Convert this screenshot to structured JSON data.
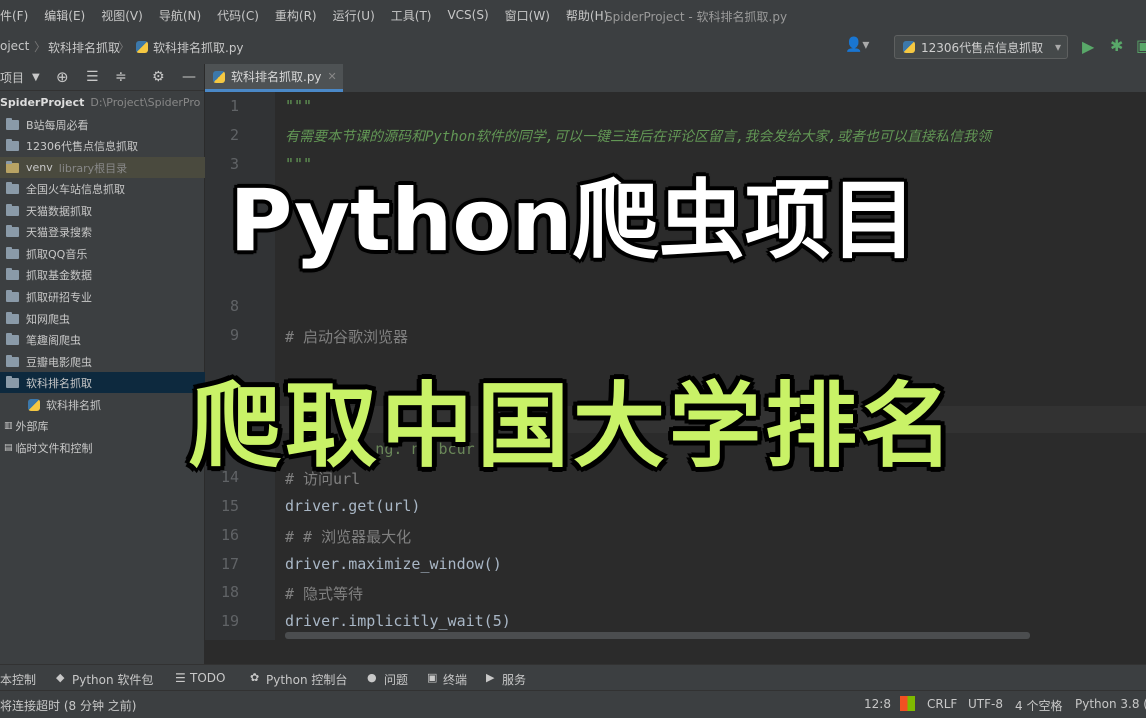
{
  "menubar": {
    "items": [
      "件(F)",
      "编辑(E)",
      "视图(V)",
      "导航(N)",
      "代码(C)",
      "重构(R)",
      "运行(U)",
      "工具(T)",
      "VCS(S)",
      "窗口(W)",
      "帮助(H)"
    ],
    "window_title": "SpiderProject - 软科排名抓取.py"
  },
  "navbar": {
    "crumb_project": "oject",
    "crumb_folder": "软科排名抓取",
    "crumb_file": "软科排名抓取.py",
    "run_config": "12306代售点信息抓取"
  },
  "sidebar": {
    "toolbar_label": "项目",
    "root_name": "SpiderProject",
    "root_path": "D:\\Project\\SpiderPro",
    "items": [
      {
        "label": "B站每周必看"
      },
      {
        "label": "12306代售点信息抓取"
      },
      {
        "label": "venv",
        "extra": "library根目录"
      },
      {
        "label": "全国火车站信息抓取"
      },
      {
        "label": "天猫数据抓取"
      },
      {
        "label": "天猫登录搜索"
      },
      {
        "label": "抓取QQ音乐"
      },
      {
        "label": "抓取基金数据"
      },
      {
        "label": "抓取研招专业"
      },
      {
        "label": "知网爬虫"
      },
      {
        "label": "笔趣阁爬虫"
      },
      {
        "label": "豆瓣电影爬虫"
      },
      {
        "label": "软科排名抓取"
      }
    ],
    "file_item": "软科排名抓",
    "external_libs": "外部库",
    "scratches": "临时文件和控制"
  },
  "editor": {
    "tab_label": "软科排名抓取.py",
    "lines": [
      {
        "n": "1",
        "text": "\"\"\"",
        "cls": "c-doc"
      },
      {
        "n": "2",
        "text": "有需要本节课的源码和Python软件的同学,可以一键三连后在评论区留言,我会发给大家,或者也可以直接私信我领",
        "cls": "c-doc"
      },
      {
        "n": "3",
        "text": "\"\"\"",
        "cls": "c-doc"
      },
      {
        "n": "8",
        "text": "",
        "cls": "c-plain"
      },
      {
        "n": "9",
        "text": "# 启动谷歌浏览器",
        "cls": "c-comment"
      },
      {
        "n": "14",
        "text": "# 访问url",
        "cls": "c-comment"
      },
      {
        "n": "15",
        "text": "driver.get(url)",
        "cls": "c-plain"
      },
      {
        "n": "16",
        "text": "# # 浏览器最大化",
        "cls": "c-comment"
      },
      {
        "n": "17",
        "text": "driver.maximize_window()",
        "cls": "c-plain"
      },
      {
        "n": "18",
        "text": "# 隐式等待",
        "cls": "c-comment"
      },
      {
        "n": "19",
        "text": "driver.implicitly_wait(5)",
        "cls": "c-plain"
      }
    ],
    "partial_url": "\"ht    //www         ng.       nk      bcur"
  },
  "overlay": {
    "title": "Python爬虫项目",
    "subtitle": "爬取中国大学排名"
  },
  "bottom_tools": {
    "items": [
      "本控制",
      "Python 软件包",
      "TODO",
      "Python 控制台",
      "问题",
      "终端",
      "服务"
    ]
  },
  "statusbar": {
    "message": "将连接超时 (8 分钟 之前)",
    "position": "12:8",
    "line_sep": "CRLF",
    "encoding": "UTF-8",
    "indent": "4 个空格",
    "interpreter": "Python 3.8 ("
  }
}
